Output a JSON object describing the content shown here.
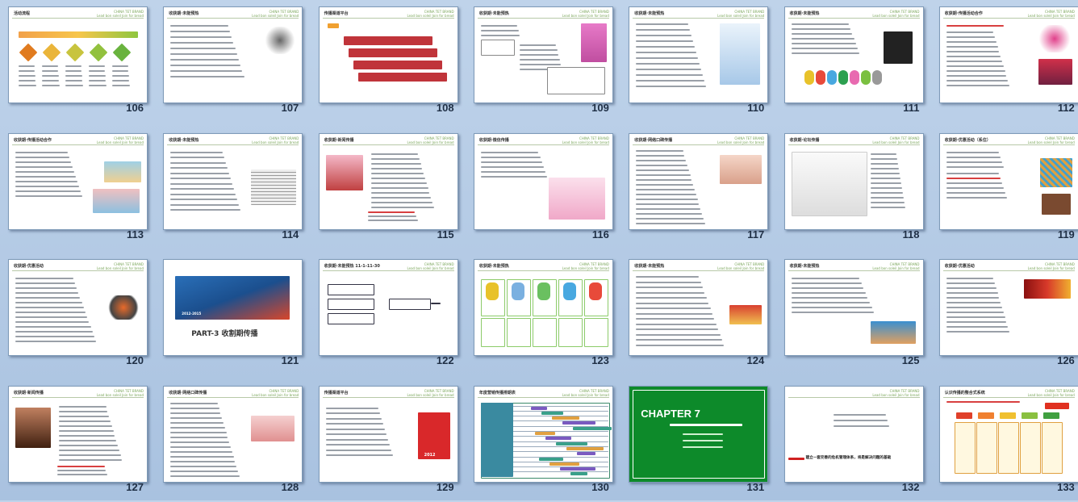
{
  "slides": [
    {
      "num": "106",
      "title": "活动流程",
      "variant": "flow"
    },
    {
      "num": "107",
      "title": "收获期·未能预热",
      "variant": "text-sketch"
    },
    {
      "num": "108",
      "title": "传播渠道平台",
      "variant": "arrows-red"
    },
    {
      "num": "109",
      "title": "收获期·未能预热",
      "variant": "text-photo-pink"
    },
    {
      "num": "110",
      "title": "收获期·未能预热",
      "variant": "text-photo-girl"
    },
    {
      "num": "111",
      "title": "收获期·未能预热",
      "variant": "text-mascots"
    },
    {
      "num": "112",
      "title": "收获期·传播活动合作",
      "variant": "text-logo-red"
    },
    {
      "num": "113",
      "title": "收获期·传播活动合作",
      "variant": "text-kids"
    },
    {
      "num": "114",
      "title": "收获期·未能预热",
      "variant": "text-newspaper"
    },
    {
      "num": "115",
      "title": "收获期·新闻传播",
      "variant": "photo-text-red"
    },
    {
      "num": "116",
      "title": "收获期·微信传播",
      "variant": "text-website"
    },
    {
      "num": "117",
      "title": "收获期·网络口碑传播",
      "variant": "text-hand"
    },
    {
      "num": "118",
      "title": "收获期·论坛传播",
      "variant": "website-list"
    },
    {
      "num": "119",
      "title": "收获期·优惠活动（系住）",
      "variant": "text-collage"
    },
    {
      "num": "120",
      "title": "收获期·优惠活动",
      "variant": "text-shoes"
    },
    {
      "num": "121",
      "title": "PART-3 收割期传播",
      "variant": "part3"
    },
    {
      "num": "122",
      "title": "收获期·未能预热 11-1-11-30",
      "variant": "flowboxes"
    },
    {
      "num": "123",
      "title": "收获期·未能预热",
      "variant": "mascot-grid"
    },
    {
      "num": "124",
      "title": "收获期·未能预热",
      "variant": "text-crowd"
    },
    {
      "num": "125",
      "title": "收获期·未能预热",
      "variant": "text-group"
    },
    {
      "num": "126",
      "title": "收获期·优惠活动",
      "variant": "text-banner"
    },
    {
      "num": "127",
      "title": "收获期·新闻传播",
      "variant": "photo-text-red2"
    },
    {
      "num": "128",
      "title": "收获期·网络口碑传播",
      "variant": "text-hand2"
    },
    {
      "num": "129",
      "title": "传播渠道平台",
      "variant": "text-calendar"
    },
    {
      "num": "130",
      "title": "年度营销传播排期表",
      "variant": "gantt"
    },
    {
      "num": "131",
      "title": "CHAPTER 7",
      "variant": "chapter"
    },
    {
      "num": "132",
      "title": "",
      "variant": "arrow-text"
    },
    {
      "num": "133",
      "title": "认识传播的整合式系统",
      "variant": "org-chart"
    }
  ],
  "text": {
    "brand_line1": "CHINA TET BRAND",
    "brand_line2": "Lead bon soleil  Join for bread",
    "part3_title": "PART-3   收割期传播",
    "part3_tag": "2012-2015",
    "chapter_title": "CHAPTER 7",
    "slide132_line": "建立一套完善的危机管理体系，将是解决问题的基础",
    "slide129_year": "2012",
    "slide133_tag": "危机管理"
  }
}
